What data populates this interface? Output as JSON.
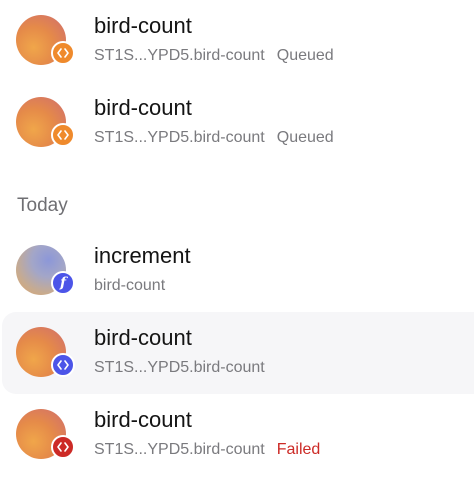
{
  "colors": {
    "badge_contract_pending": "#ef8a2c",
    "badge_contract_active": "#4c55e8",
    "badge_contract_failed": "#cc2a26",
    "badge_function": "#4c55e8",
    "status_failed_text": "#cc2a26",
    "selected_row_bg": "#f6f6f8"
  },
  "section": {
    "today_label": "Today"
  },
  "transactions": [
    {
      "title": "bird-count",
      "subtitle": "ST1S...YPD5.bird-count",
      "status": "Queued",
      "badge_icon": "code-brackets-icon"
    },
    {
      "title": "bird-count",
      "subtitle": "ST1S...YPD5.bird-count",
      "status": "Queued",
      "badge_icon": "code-brackets-icon"
    },
    {
      "title": "increment",
      "subtitle": "bird-count",
      "status": "",
      "badge_icon": "function-icon"
    },
    {
      "title": "bird-count",
      "subtitle": "ST1S...YPD5.bird-count",
      "status": "",
      "badge_icon": "code-brackets-icon"
    },
    {
      "title": "bird-count",
      "subtitle": "ST1S...YPD5.bird-count",
      "status": "Failed",
      "badge_icon": "code-brackets-icon"
    }
  ]
}
